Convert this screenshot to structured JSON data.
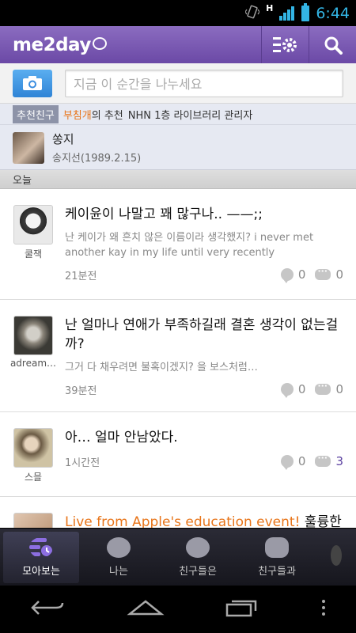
{
  "status_bar": {
    "time": "6:44",
    "network": "H"
  },
  "app_bar": {
    "logo": "me2day",
    "settings_icon": "settings-list-icon",
    "search_icon": "search-icon"
  },
  "compose": {
    "placeholder": "지금 이 순간을 나누세요",
    "camera_icon": "camera-icon"
  },
  "recommend": {
    "tag": "추천친구",
    "by_name": "부침개",
    "by_suffix": "의 추천",
    "group": "NHN 1층 라이브러리 관리자",
    "nickname": "쏭지",
    "realname": "송지선(1989.2.15)"
  },
  "section": {
    "label": "오늘"
  },
  "posts": [
    {
      "author": "쿨잭",
      "text": "케이윤이 나말고 꽤 많구나.. ——;;",
      "text_highlight": "",
      "sub": "난 케이가 왜 흔치 않은 이름이라 생각했지? i never met another kay in my life until very recently",
      "time": "21분전",
      "metoo": "0",
      "comments": "0"
    },
    {
      "author": "adream…",
      "text": "난 얼마나 연애가 부족하길래 결혼 생각이 없는걸까?",
      "text_highlight": "",
      "sub": "그거 다 채우려면 불혹이겠지? 을 보스처럼…",
      "time": "39분전",
      "metoo": "0",
      "comments": "0"
    },
    {
      "author": "스믈",
      "text": "아… 얼마 안남았다.",
      "text_highlight": "",
      "sub": "",
      "time": "1시간전",
      "metoo": "0",
      "comments": "3"
    },
    {
      "author": "",
      "text": " 훌륭한",
      "text_highlight": "Live from Apple's education event!",
      "sub": "",
      "time": "",
      "metoo": "",
      "comments": ""
    }
  ],
  "tabs": [
    {
      "label": "모아보는",
      "icon": "collect-icon",
      "active": true
    },
    {
      "label": "나는",
      "icon": "me-icon",
      "active": false
    },
    {
      "label": "친구들은",
      "icon": "friends-icon",
      "active": false
    },
    {
      "label": "친구들과",
      "icon": "chat-icon",
      "active": false
    }
  ],
  "nav": {
    "back_icon": "back-icon",
    "home_icon": "home-icon",
    "recent_icon": "recent-apps-icon",
    "menu_icon": "menu-icon"
  },
  "colors": {
    "accent": "#7b5cb5",
    "highlight": "#e8751a",
    "status_blue": "#33b5e5"
  }
}
